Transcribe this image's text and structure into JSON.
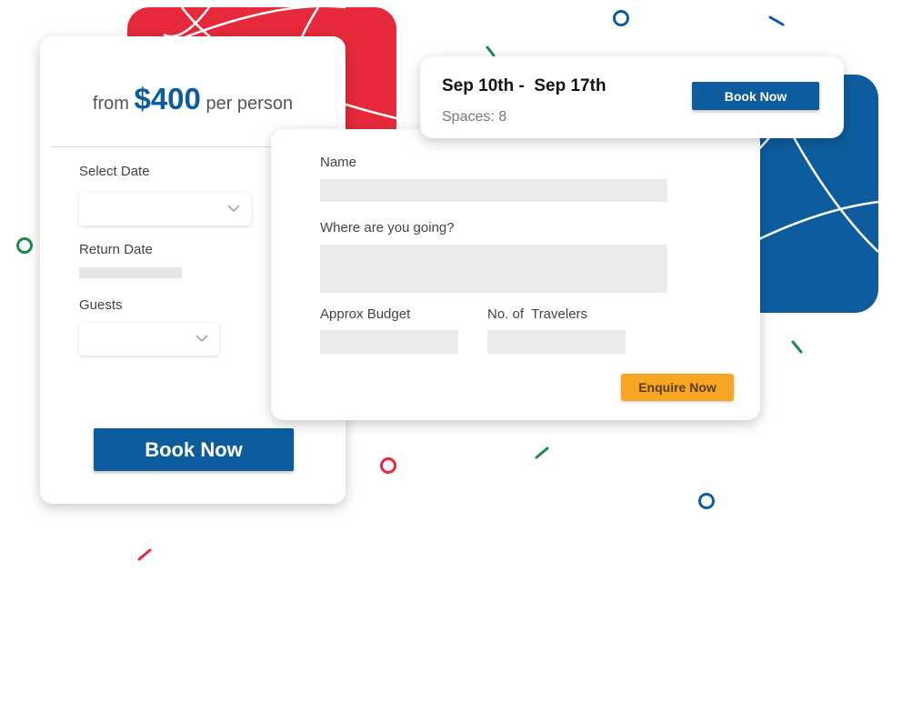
{
  "booking_card": {
    "price_prefix": "from",
    "price_amount": "$400",
    "price_suffix": "per person",
    "select_date_label": "Select Date",
    "return_date_label": "Return Date",
    "guests_label": "Guests",
    "book_button_label": "Book Now"
  },
  "enquiry_card": {
    "name_label": "Name",
    "destination_label": "Where are you going?",
    "budget_label": "Approx Budget",
    "travelers_label": "No. of  Travelers",
    "enquire_button_label": "Enquire Now"
  },
  "dates_card": {
    "date_range": "Sep 10th -  Sep 17th",
    "spaces": "Spaces: 8",
    "book_button_label": "Book Now"
  },
  "colors": {
    "brand_blue": "#0d5d9e",
    "accent_red": "#e62a3b",
    "accent_orange": "#f6a623",
    "confetti_green": "#1a8a4a"
  },
  "icons": {
    "select_date_dropdown": "chevron-down-icon",
    "guests_dropdown": "chevron-down-icon"
  }
}
